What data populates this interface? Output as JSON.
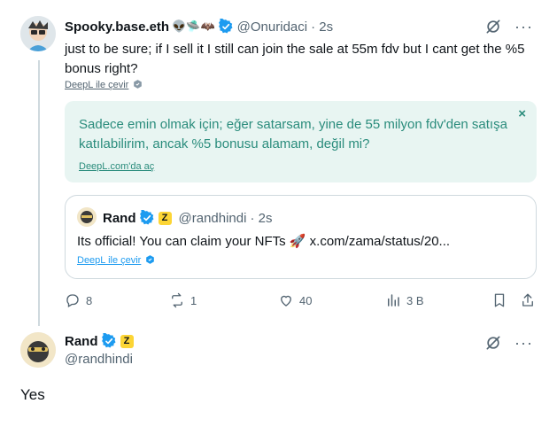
{
  "reply": {
    "display_name": "Spooky.base.eth",
    "name_emojis": "👽🛸🦇",
    "handle": "@Onuridaci",
    "time": "· 2s",
    "text": "just to be sure; if I sell it I still can join the sale at 55m fdv but I cant get the %5 bonus right?",
    "deepl_label": "DeepL ile çevir",
    "translation": {
      "text": "Sadece emin olmak için; eğer satarsam, yine de 55 milyon fdv'den satışa katılabilirim, ancak %5 bonusu alamam, değil mi?",
      "link": "DeepL.com'da aç",
      "close": "×"
    },
    "quote": {
      "display_name": "Rand",
      "badge": "Z",
      "handle": "@randhindi",
      "time": "· 2s",
      "text": "Its official! You can claim your NFTs 🚀 x.com/zama/status/20...",
      "deepl_label": "DeepL ile çevir"
    },
    "actions": {
      "replies": "8",
      "reposts": "1",
      "likes": "40",
      "views": "3 B"
    },
    "more_label": "···"
  },
  "main": {
    "display_name": "Rand",
    "badge": "Z",
    "handle": "@randhindi",
    "text": "Yes",
    "more_label": "···"
  },
  "colors": {
    "accent": "#1d9bf0",
    "translation_bg": "#e8f5f2",
    "translation_text": "#2a8c7c",
    "muted": "#536471"
  }
}
